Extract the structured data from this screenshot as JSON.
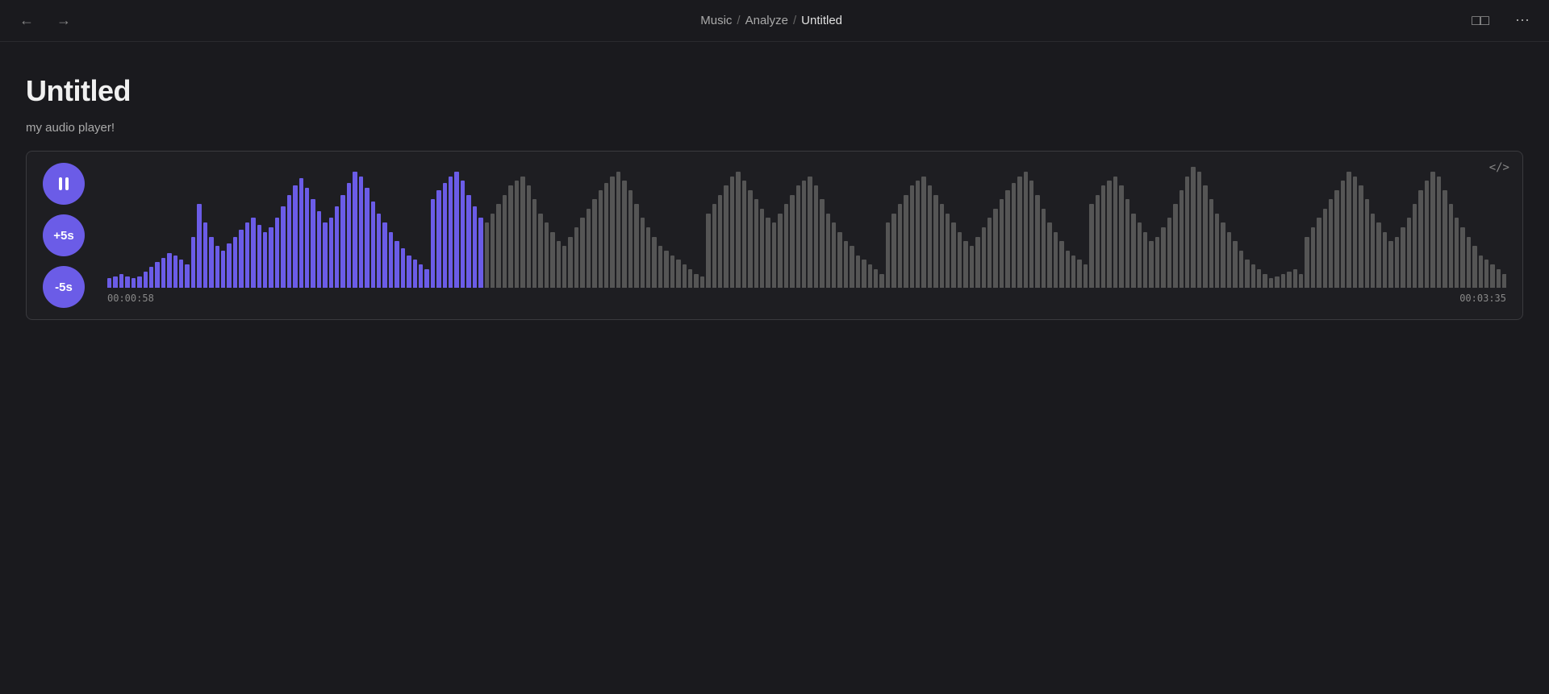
{
  "topbar": {
    "breadcrumb": {
      "part1": "Music",
      "sep1": "/",
      "part2": "Analyze",
      "sep2": "/",
      "part3": "Untitled"
    }
  },
  "page": {
    "title": "Untitled",
    "subtitle": "my audio player!"
  },
  "player": {
    "pause_label": "",
    "skip_forward_label": "+5s",
    "skip_back_label": "-5s",
    "time_start": "00:00:58",
    "time_end": "00:03:35",
    "code_icon_label": "</>",
    "playback_position_fraction": 0.27,
    "bars": [
      4,
      5,
      6,
      5,
      4,
      5,
      7,
      9,
      11,
      13,
      15,
      14,
      12,
      10,
      22,
      36,
      28,
      22,
      18,
      16,
      19,
      22,
      25,
      28,
      30,
      27,
      24,
      26,
      30,
      35,
      40,
      44,
      47,
      43,
      38,
      33,
      28,
      30,
      35,
      40,
      45,
      50,
      48,
      43,
      37,
      32,
      28,
      24,
      20,
      17,
      14,
      12,
      10,
      8,
      38,
      42,
      45,
      48,
      50,
      46,
      40,
      35,
      30,
      28,
      32,
      36,
      40,
      44,
      46,
      48,
      44,
      38,
      32,
      28,
      24,
      20,
      18,
      22,
      26,
      30,
      34,
      38,
      42,
      45,
      48,
      50,
      46,
      42,
      36,
      30,
      26,
      22,
      18,
      16,
      14,
      12,
      10,
      8,
      6,
      5,
      32,
      36,
      40,
      44,
      48,
      50,
      46,
      42,
      38,
      34,
      30,
      28,
      32,
      36,
      40,
      44,
      46,
      48,
      44,
      38,
      32,
      28,
      24,
      20,
      18,
      14,
      12,
      10,
      8,
      6,
      28,
      32,
      36,
      40,
      44,
      46,
      48,
      44,
      40,
      36,
      32,
      28,
      24,
      20,
      18,
      22,
      26,
      30,
      34,
      38,
      42,
      45,
      48,
      50,
      46,
      40,
      34,
      28,
      24,
      20,
      16,
      14,
      12,
      10,
      36,
      40,
      44,
      46,
      48,
      44,
      38,
      32,
      28,
      24,
      20,
      22,
      26,
      30,
      36,
      42,
      48,
      52,
      50,
      44,
      38,
      32,
      28,
      24,
      20,
      16,
      12,
      10,
      8,
      6,
      4,
      5,
      6,
      7,
      8,
      6,
      22,
      26,
      30,
      34,
      38,
      42,
      46,
      50,
      48,
      44,
      38,
      32,
      28,
      24,
      20,
      22,
      26,
      30,
      36,
      42,
      46,
      50,
      48,
      42,
      36,
      30,
      26,
      22,
      18,
      14,
      12,
      10,
      8,
      6
    ]
  }
}
